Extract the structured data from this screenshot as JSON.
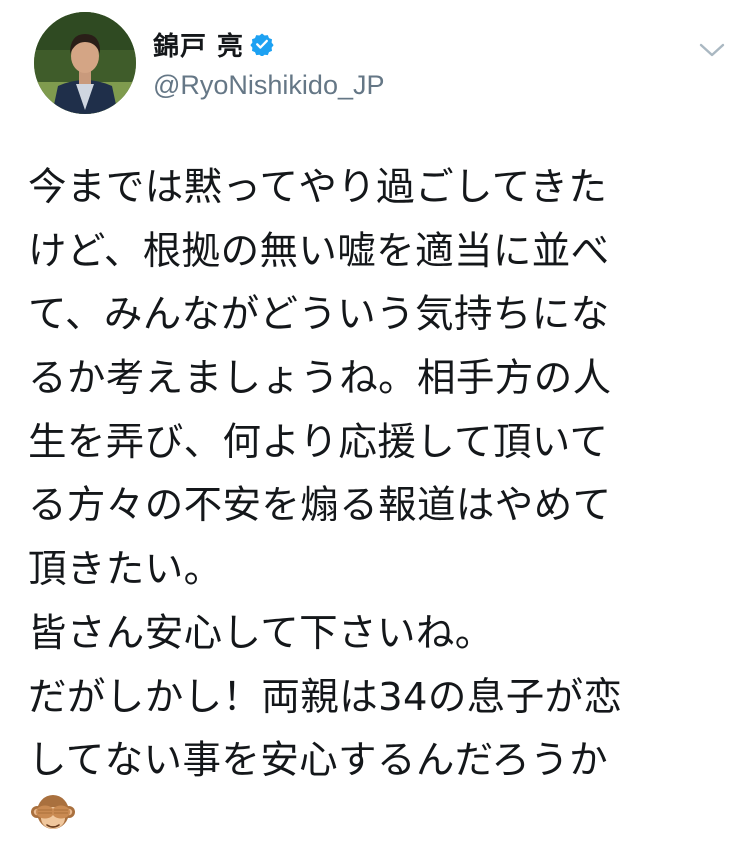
{
  "author": {
    "display_name": "錦戸 亮",
    "handle": "@RyoNishikido_JP",
    "verified": true,
    "accent_color": "#1da1f2"
  },
  "tweet": {
    "lines": [
      "今までは黙ってやり過ごしてきた",
      "けど、根拠の無い嘘を適当に並べ",
      "て、みんながどういう気持ちにな",
      "るか考えましょうね。相手方の人",
      "生を弄び、何より応援して頂いて",
      "る方々の不安を煽る報道はやめて",
      "頂きたい。",
      "皆さん安心して下さいね。",
      "だがしかし！両親は34の息子が恋",
      "してない事を安心するんだろうか"
    ],
    "trailing_emoji": "see-no-evil-monkey"
  },
  "icons": {
    "verified": "verified-badge-icon",
    "menu": "chevron-down-icon",
    "emoji": "see-no-evil-monkey-icon"
  }
}
